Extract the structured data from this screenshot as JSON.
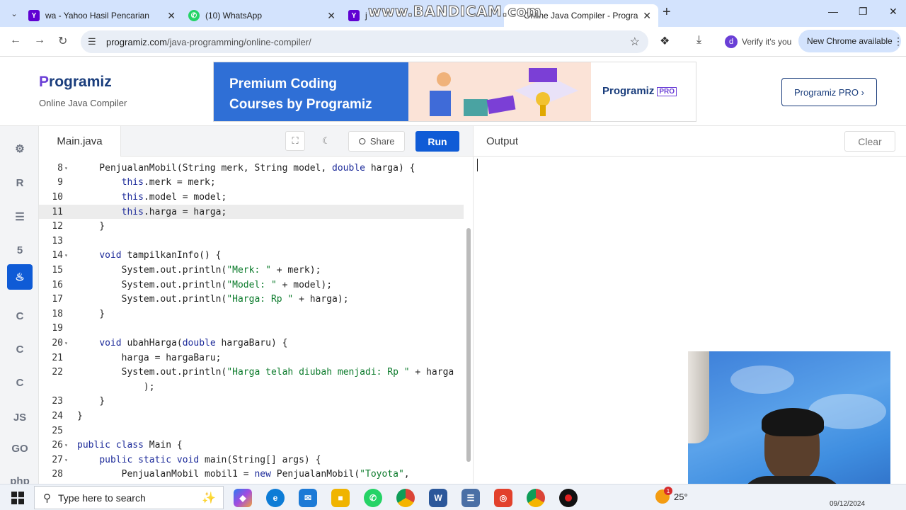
{
  "browser": {
    "tabs": [
      {
        "title": "wa - Yahoo Hasil Pencarian",
        "favicon": "yahoo-icon"
      },
      {
        "title": "(10) WhatsApp",
        "favicon": "whatsapp-icon"
      },
      {
        "title": "j",
        "favicon": "yahoo-icon"
      },
      {
        "title": "Online Java Compiler - Progra",
        "favicon": "programiz-icon",
        "active": true
      }
    ],
    "watermark": "www.BANDICAM.com",
    "url_host": "programiz.com",
    "url_path": "/java-programming/online-compiler/",
    "verify_label": "Verify it's you",
    "verify_avatar": "d",
    "new_chrome_label": "New Chrome available"
  },
  "header": {
    "logo_text": "rogramiz",
    "logo_initial": "P",
    "subtitle": "Online Java Compiler",
    "banner_line1": "Premium Coding",
    "banner_line2": "Courses by Programiz",
    "banner_logo": "Programiz",
    "banner_pro": "PRO",
    "pro_button": "Programiz PRO ›"
  },
  "rail": {
    "items": [
      {
        "name": "python-icon",
        "glyph": "⚙"
      },
      {
        "name": "r-icon",
        "glyph": "R"
      },
      {
        "name": "sql-icon",
        "glyph": "☰"
      },
      {
        "name": "html-icon",
        "glyph": "5"
      },
      {
        "name": "java-icon",
        "glyph": "♨",
        "active": true
      },
      {
        "name": "c-icon",
        "glyph": "C"
      },
      {
        "name": "cpp-icon",
        "glyph": "C"
      },
      {
        "name": "csharp-icon",
        "glyph": "C"
      },
      {
        "name": "js-icon",
        "glyph": "JS"
      },
      {
        "name": "go-icon",
        "glyph": "GO"
      },
      {
        "name": "php-icon",
        "glyph": "php"
      }
    ]
  },
  "editor": {
    "filename": "Main.java",
    "share_label": "Share",
    "run_label": "Run",
    "lines": [
      {
        "n": "8",
        "fold": true,
        "code": "    PenjualanMobil(String merk, String model, double harga) {"
      },
      {
        "n": "9",
        "fold": false,
        "code": "        this.merk = merk;"
      },
      {
        "n": "10",
        "fold": false,
        "code": "        this.model = model;"
      },
      {
        "n": "11",
        "fold": false,
        "code": "        this.harga = harga;",
        "highlight": true
      },
      {
        "n": "12",
        "fold": false,
        "code": "    }"
      },
      {
        "n": "13",
        "fold": false,
        "code": ""
      },
      {
        "n": "14",
        "fold": true,
        "code": "    void tampilkanInfo() {"
      },
      {
        "n": "15",
        "fold": false,
        "code": "        System.out.println(\"Merk: \" + merk);"
      },
      {
        "n": "16",
        "fold": false,
        "code": "        System.out.println(\"Model: \" + model);"
      },
      {
        "n": "17",
        "fold": false,
        "code": "        System.out.println(\"Harga: Rp \" + harga);"
      },
      {
        "n": "18",
        "fold": false,
        "code": "    }"
      },
      {
        "n": "19",
        "fold": false,
        "code": ""
      },
      {
        "n": "20",
        "fold": true,
        "code": "    void ubahHarga(double hargaBaru) {"
      },
      {
        "n": "21",
        "fold": false,
        "code": "        harga = hargaBaru;"
      },
      {
        "n": "22",
        "fold": false,
        "code": "        System.out.println(\"Harga telah diubah menjadi: Rp \" + harga"
      },
      {
        "n": "",
        "fold": false,
        "code": "            );"
      },
      {
        "n": "23",
        "fold": false,
        "code": "    }"
      },
      {
        "n": "24",
        "fold": false,
        "code": "}"
      },
      {
        "n": "25",
        "fold": false,
        "code": ""
      },
      {
        "n": "26",
        "fold": true,
        "code": "public class Main {"
      },
      {
        "n": "27",
        "fold": true,
        "code": "    public static void main(String[] args) {"
      },
      {
        "n": "28",
        "fold": false,
        "code": "        PenjualanMobil mobil1 = new PenjualanMobil(\"Toyota\","
      }
    ]
  },
  "output": {
    "title": "Output",
    "clear_label": "Clear"
  },
  "taskbar": {
    "search_placeholder": "Type here to search",
    "weather_temp": "25°",
    "weather_badge": "1",
    "date": "09/12/2024"
  }
}
